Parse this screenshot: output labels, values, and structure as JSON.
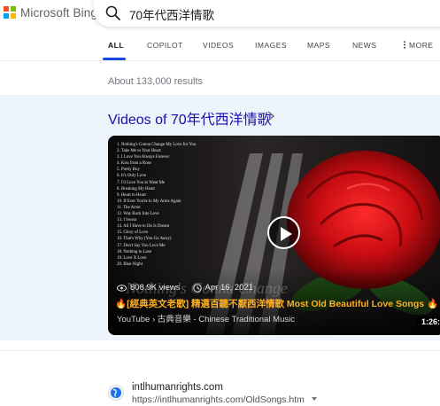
{
  "brand": {
    "logo_text": "Microsoft Bing",
    "logo_colors": [
      "#f25022",
      "#7fba00",
      "#00a4ef",
      "#ffb900"
    ]
  },
  "search": {
    "query": "70年代西洋情歌",
    "icon": "search-icon"
  },
  "nav": {
    "tabs": [
      {
        "label": "ALL",
        "active": true
      },
      {
        "label": "COPILOT",
        "active": false
      },
      {
        "label": "VIDEOS",
        "active": false
      },
      {
        "label": "IMAGES",
        "active": false
      },
      {
        "label": "MAPS",
        "active": false
      },
      {
        "label": "NEWS",
        "active": false
      }
    ],
    "more_label": "MORE",
    "accent_color": "#174ae4"
  },
  "results": {
    "count_text": "About 133,000 results"
  },
  "videos": {
    "heading": "Videos of 70年代西洋情歌",
    "card": {
      "song_list": [
        "1. Nothing's Gonna Change My Love for You",
        "2. Take Me to Your Heart",
        "3. I Love You Always Forever",
        "4. Kiss from a Rose",
        "5. Pretty Boy",
        "6. It's Only Love",
        "7. I'd Love You to Want Me",
        "8. Breaking My Heart",
        "9. Heart to Heart",
        "10. If Ever You're in My Arms Again",
        "11. The Actor",
        "12. Way Back Into Love",
        "13. I Swear",
        "14. All I Have to Do Is Dream",
        "15. Glory of Love",
        "16. That's Why (You Go Away)",
        "17. Don't Say You Love Me",
        "18. Nothing to Lose",
        "19. Love X Love",
        "20. Blue Night"
      ],
      "views": "808.9K views",
      "date": "Apr 16, 2021",
      "title": "[經典英文老歌] 精選百聽不厭西洋情歌  Most Old Beautiful Love Songs",
      "source": "YouTube › 古典音樂 - Chinese Traditional Music",
      "duration": "1:26:",
      "title_color": "#ffb020"
    }
  },
  "result_item": {
    "site": "intlhumanrights.com",
    "url": "https://intlhumanrights.com/OldSongs.htm"
  }
}
